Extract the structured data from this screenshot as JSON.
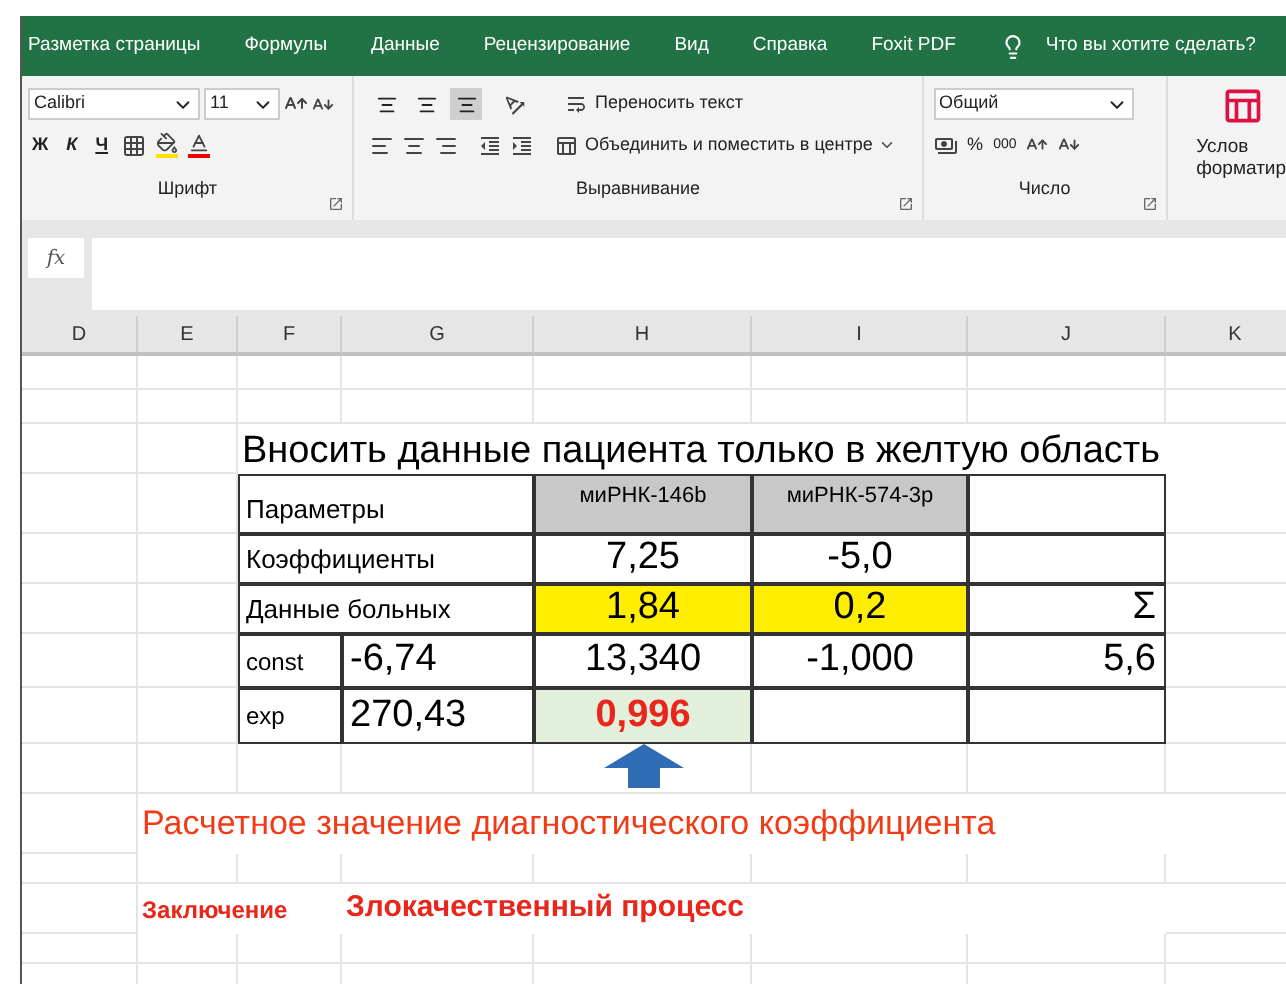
{
  "ribbon_tabs": [
    "Разметка страницы",
    "Формулы",
    "Данные",
    "Рецензирование",
    "Вид",
    "Справка",
    "Foxit PDF"
  ],
  "tell_me": "Что вы хотите сделать?",
  "font_group": {
    "font": "Calibri",
    "size": "11",
    "bold": "Ж",
    "italic": "К",
    "underline": "Ч",
    "label": "Шрифт"
  },
  "alignment_group": {
    "vertical": [
      {
        "selected": false
      },
      {
        "selected": false
      },
      {
        "selected": true
      }
    ],
    "wrap": "Переносить текст",
    "merge": "Объединить и поместить в центре",
    "label": "Выравнивание"
  },
  "number_group": {
    "format": "Общий",
    "percent": "%",
    "thousands": "000",
    "label": "Число"
  },
  "styles_group": {
    "line_1": "Услов",
    "line_2": "форматир"
  },
  "formula_bar": {
    "function_label": "fx"
  },
  "columns": [
    "D",
    "E",
    "F",
    "G",
    "H",
    "I",
    "J",
    "K"
  ],
  "sheet": {
    "title": "Вносить данные пациента только в желтую область",
    "table": {
      "rows": [
        {
          "label": "Параметры",
          "cells": [
            {
              "kind": "header",
              "text": "миРНК-146b"
            },
            {
              "kind": "header",
              "text": "миРНК-574-3р"
            },
            {
              "kind": "plain"
            }
          ]
        },
        {
          "label": "Коэффициенты",
          "cells": [
            {
              "kind": "plain",
              "text": "7,25"
            },
            {
              "kind": "plain",
              "text": "-5,0"
            },
            {
              "kind": "plain"
            }
          ]
        },
        {
          "label": "Данные больных",
          "cells": [
            {
              "kind": "input",
              "text": "1,84"
            },
            {
              "kind": "input",
              "text": "0,2"
            },
            {
              "kind": "total",
              "text": "Σ"
            }
          ]
        },
        {
          "label": "const",
          "value": "-6,74",
          "cells": [
            {
              "kind": "plain",
              "text": "13,340"
            },
            {
              "kind": "plain",
              "text": "-1,000"
            },
            {
              "kind": "total",
              "text": "5,6"
            }
          ]
        },
        {
          "label": "exp",
          "value": "270,43",
          "cells": [
            {
              "kind": "result",
              "text": "0,996"
            },
            {
              "kind": "plain"
            },
            {
              "kind": "plain"
            }
          ]
        }
      ]
    },
    "note": "Расчетное значение диагностического коэффициента",
    "conclusion_label": "Заключение",
    "conclusion": "Злокачественный процесс"
  }
}
